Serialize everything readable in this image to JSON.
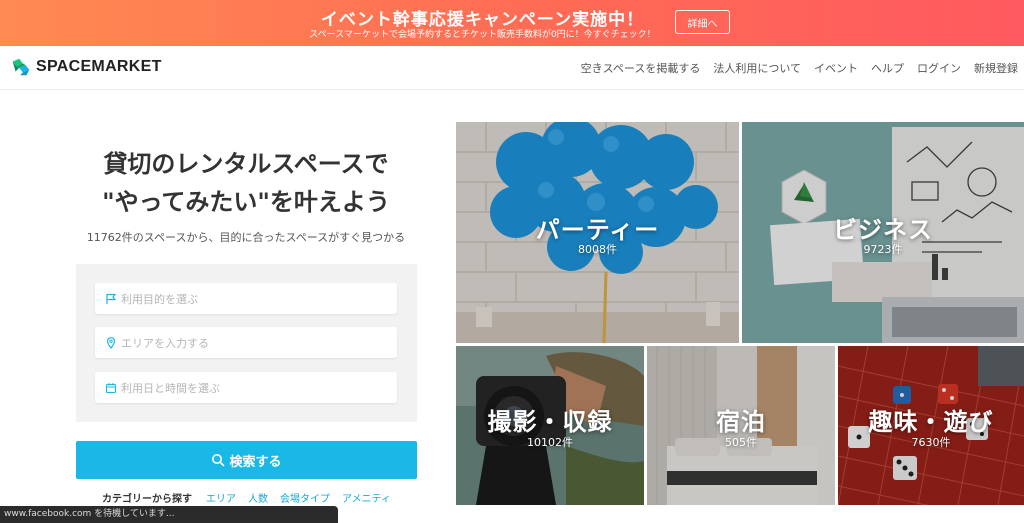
{
  "promo": {
    "title": "イベント幹事応援キャンペーン実施中！",
    "subtitle": "スペースマーケットで会場予約するとチケット販売手数料が0円に！今すぐチェック！",
    "button": "詳細へ"
  },
  "nav": {
    "logo": "SPACEMARKET",
    "links": [
      "空きスペースを掲載する",
      "法人利用について",
      "イベント",
      "ヘルプ",
      "ログイン",
      "新規登録"
    ]
  },
  "hero": {
    "title_line1": "貸切のレンタルスペースで",
    "title_line2": "\"やってみたい\"を叶えよう",
    "subtitle": "11762件のスペースから、目的に合ったスペースがすぐ見つかる"
  },
  "search": {
    "purpose_placeholder": "利用目的を選ぶ",
    "area_placeholder": "エリアを入力する",
    "date_placeholder": "利用日と時間を選ぶ",
    "button": "検索する"
  },
  "categories": {
    "label": "カテゴリーから探す",
    "links": [
      "エリア",
      "人数",
      "会場タイプ",
      "アメニティ"
    ]
  },
  "tiles": [
    {
      "name": "パーティー",
      "count": "8008件"
    },
    {
      "name": "ビジネス",
      "count": "9723件"
    },
    {
      "name": "撮影・収録",
      "count": "10102件"
    },
    {
      "name": "宿泊",
      "count": "505件"
    },
    {
      "name": "趣味・遊び",
      "count": "7630件"
    }
  ],
  "status_bar": "www.facebook.com を待機しています..."
}
